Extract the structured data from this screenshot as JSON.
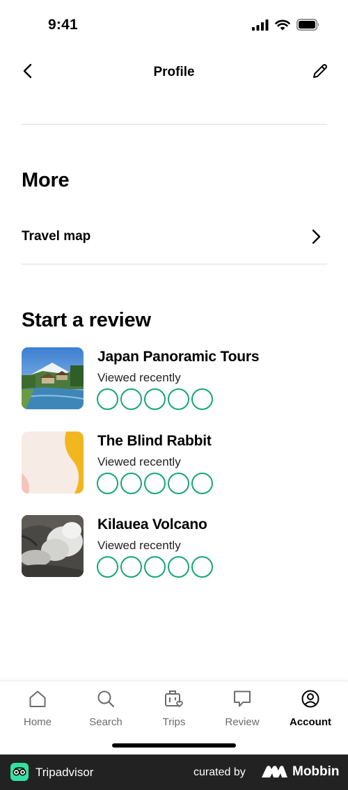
{
  "status_bar": {
    "time": "9:41"
  },
  "header": {
    "title": "Profile"
  },
  "more_section": {
    "heading": "More",
    "travel_map_label": "Travel map"
  },
  "review_section": {
    "heading": "Start a review",
    "items": [
      {
        "title": "Japan Panoramic Tours",
        "subtitle": "Viewed recently",
        "thumb": "mountain-village-photo"
      },
      {
        "title": "The Blind Rabbit",
        "subtitle": "Viewed recently",
        "thumb": "abstract-placeholder"
      },
      {
        "title": "Kilauea Volcano",
        "subtitle": "Viewed recently",
        "thumb": "volcano-steam-photo"
      }
    ],
    "rating_bubbles": 5,
    "bubble_color": "#17a673"
  },
  "tabbar": {
    "tabs": [
      {
        "label": "Home",
        "icon": "home-icon"
      },
      {
        "label": "Search",
        "icon": "search-icon"
      },
      {
        "label": "Trips",
        "icon": "trips-icon"
      },
      {
        "label": "Review",
        "icon": "review-icon"
      },
      {
        "label": "Account",
        "icon": "account-icon",
        "active": true
      }
    ]
  },
  "footer": {
    "brand": "Tripadvisor",
    "curated_by": "curated by",
    "curator": "Mobbin"
  }
}
